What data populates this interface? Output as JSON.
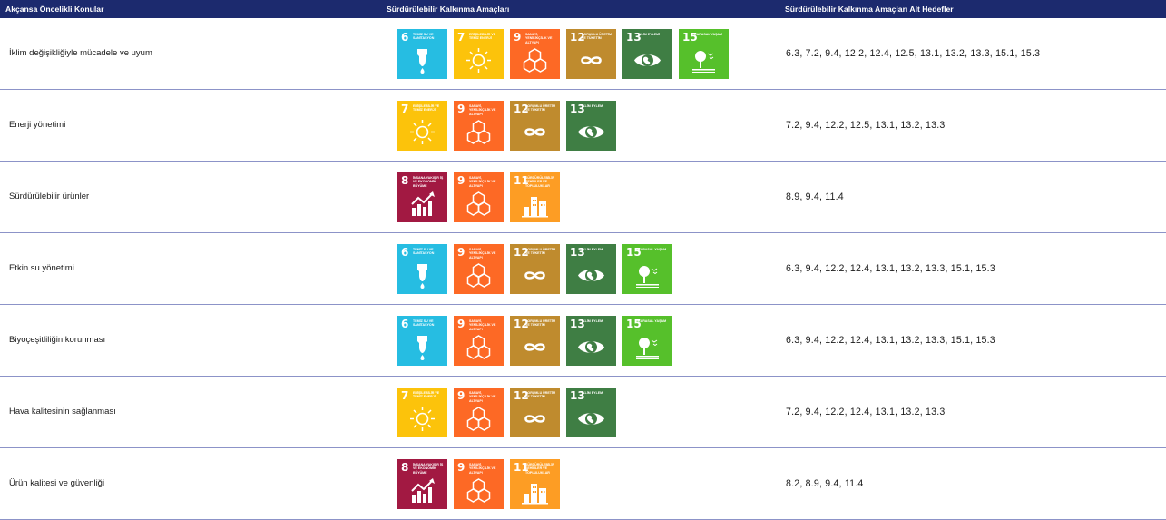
{
  "header": {
    "col1": "Akçansa Öncelikli Konular",
    "col2": "Sürdürülebilir Kalkınma Amaçları",
    "col3": "Sürdürülebilir Kalkınma Amaçları Alt Hedefler"
  },
  "goals": {
    "6": {
      "num": "6",
      "label": "TEMİZ SU VE SANİTASYON",
      "color": "#26bde2",
      "icon": "water-drop-icon"
    },
    "7": {
      "num": "7",
      "label": "ERİŞİLEBİLİR VE TEMİZ ENERJİ",
      "color": "#fcc30b",
      "icon": "sun-icon"
    },
    "8": {
      "num": "8",
      "label": "İNSANA YAKIŞIR İŞ VE EKONOMİK BÜYÜME",
      "color": "#a21942",
      "icon": "growth-chart-icon"
    },
    "9": {
      "num": "9",
      "label": "SANAYİ, YENİLİKÇİLİK VE ALTYAPI",
      "color": "#fd6925",
      "icon": "cubes-icon"
    },
    "11": {
      "num": "11",
      "label": "SÜRDÜRÜLEBİLİR ŞEHİRLER VE TOPLULUKLAR",
      "color": "#fd9d24",
      "icon": "city-icon"
    },
    "12": {
      "num": "12",
      "label": "SORUMLU ÜRETİM VE TÜKETİM",
      "color": "#bf8b2e",
      "icon": "infinity-icon"
    },
    "13": {
      "num": "13",
      "label": "İKLİM EYLEMİ",
      "color": "#3f7e44",
      "icon": "earth-eye-icon"
    },
    "15": {
      "num": "15",
      "label": "KARASAL YAŞAM",
      "color": "#56c02b",
      "icon": "tree-bird-icon"
    }
  },
  "rows": [
    {
      "topic": "İklim değişikliğiyle mücadele ve uyum",
      "goals": [
        "6",
        "7",
        "9",
        "12",
        "13",
        "15"
      ],
      "targets": "6.3, 7.2, 9.4, 12.2, 12.4, 12.5, 13.1, 13.2, 13.3, 15.1, 15.3"
    },
    {
      "topic": "Enerji yönetimi",
      "goals": [
        "7",
        "9",
        "12",
        "13"
      ],
      "targets": "7.2, 9.4, 12.2, 12.5, 13.1, 13.2, 13.3"
    },
    {
      "topic": "Sürdürülebilir ürünler",
      "goals": [
        "8",
        "9",
        "11"
      ],
      "targets": "8.9, 9.4, 11.4"
    },
    {
      "topic": "Etkin su yönetimi",
      "goals": [
        "6",
        "9",
        "12",
        "13",
        "15"
      ],
      "targets": "6.3, 9.4, 12.2, 12.4, 13.1, 13.2, 13.3, 15.1, 15.3"
    },
    {
      "topic": "Biyoçeşitliliğin korunması",
      "goals": [
        "6",
        "9",
        "12",
        "13",
        "15"
      ],
      "targets": "6.3, 9.4, 12.2, 12.4, 13.1, 13.2, 13.3, 15.1, 15.3"
    },
    {
      "topic": "Hava kalitesinin sağlanması",
      "goals": [
        "7",
        "9",
        "12",
        "13"
      ],
      "targets": "7.2, 9.4, 12.2, 12.4, 13.1, 13.2, 13.3"
    },
    {
      "topic": "Ürün kalitesi ve güvenliği",
      "goals": [
        "8",
        "9",
        "11"
      ],
      "targets": "8.2, 8.9, 9.4, 11.4"
    }
  ]
}
